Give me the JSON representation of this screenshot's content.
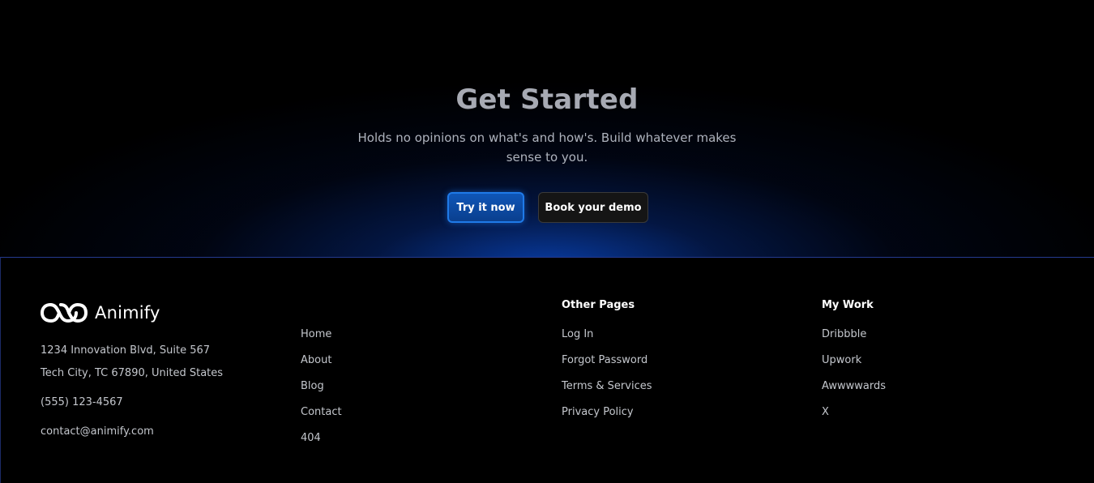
{
  "cta": {
    "title": "Get Started",
    "subtitle": "Holds no opinions on what's and how's. Build whatever makes sense to you.",
    "primary_button": "Try it now",
    "secondary_button": "Book your demo"
  },
  "footer": {
    "brand": {
      "name": "Animify",
      "logo_icon": "infinity-loop-icon"
    },
    "address_line1": "1234 Innovation Blvd, Suite 567",
    "address_line2": "Tech City, TC 67890, United States",
    "phone": "(555) 123-4567",
    "email": "contact@animify.com",
    "nav_links": [
      "Home",
      "About",
      "Blog",
      "Contact",
      "404"
    ],
    "other_pages": {
      "heading": "Other Pages",
      "links": [
        "Log In",
        "Forgot Password",
        "Terms & Services",
        "Privacy Policy"
      ]
    },
    "my_work": {
      "heading": "My Work",
      "links": [
        "Dribbble",
        "Upwork",
        "Awwwwards",
        "X"
      ]
    }
  },
  "colors": {
    "background": "#000000",
    "accent_blue": "#1f7ae8",
    "footer_border": "#253a8f",
    "muted_text": "#c4c7cd",
    "title_gray": "#a7aab3"
  }
}
